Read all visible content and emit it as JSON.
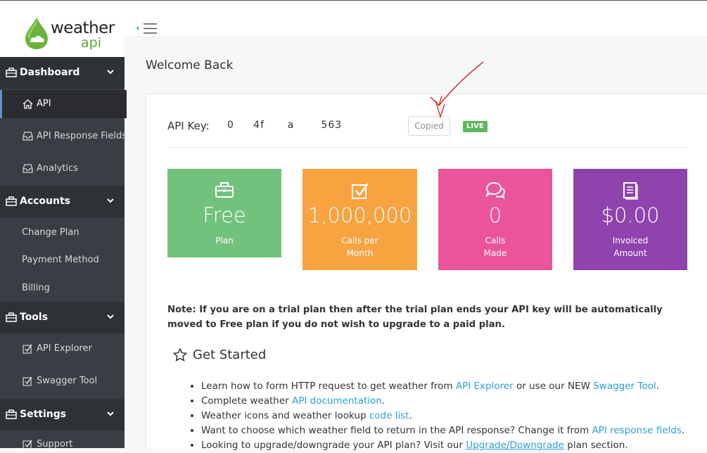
{
  "logo": {
    "word1": "weather",
    "word2": "api"
  },
  "sidebar": {
    "sections": [
      {
        "label": "Dashboard",
        "icon": "briefcase-icon"
      },
      {
        "label": "Accounts",
        "icon": "briefcase-icon"
      },
      {
        "label": "Tools",
        "icon": "briefcase-icon"
      },
      {
        "label": "Settings",
        "icon": "briefcase-icon"
      }
    ],
    "items": {
      "api": "API",
      "api_response_fields": "API Response Fields",
      "analytics": "Analytics",
      "change_plan": "Change Plan",
      "payment_method": "Payment Method",
      "billing": "Billing",
      "api_explorer": "API Explorer",
      "swagger_tool": "Swagger Tool",
      "support": "Support"
    }
  },
  "page": {
    "title": "Welcome Back"
  },
  "api": {
    "label": "API Key:",
    "key_display": "0     4f      a       563         ",
    "copied_label": "Copied",
    "status_badge": "LIVE"
  },
  "tiles": [
    {
      "value": "Free",
      "label": "Plan",
      "color": "#72c27e",
      "icon": "briefcase-icon"
    },
    {
      "value": "1,000,000",
      "label1": "Calls per",
      "label2": "Month",
      "color": "#f6a340",
      "icon": "check-square-icon"
    },
    {
      "value": "0",
      "label1": "Calls",
      "label2": "Made",
      "color": "#e9549a",
      "icon": "comments-icon"
    },
    {
      "value": "$0.00",
      "label1": "Invoiced",
      "label2": "Amount",
      "color": "#8e43ad",
      "icon": "document-icon"
    }
  ],
  "note": "Note: If you are on a trial plan then after the trial plan ends your API key will be automatically moved to Free plan if you do not wish to upgrade to a paid plan.",
  "get_started": {
    "title": "Get Started",
    "items": [
      {
        "pre": "Learn how to form HTTP request to get weather from ",
        "link1": "API Explorer",
        "mid": " or use our NEW ",
        "link2": "Swagger Tool",
        "post": "."
      },
      {
        "pre": "Complete weather ",
        "link1": "API documentation",
        "post": "."
      },
      {
        "pre": "Weather icons and weather lookup ",
        "link1": "code list",
        "post": "."
      },
      {
        "pre": "Want to choose which weather field to return in the API response? Change it from ",
        "link1": "API response fields",
        "post": "."
      },
      {
        "pre": "Looking to upgrade/downgrade your API plan? Visit our ",
        "link1": "Upgrade/Downgrade",
        "post": " plan section."
      }
    ]
  },
  "colors": {
    "sidebar_bg": "#3a3e44",
    "section_bg": "#2e3136",
    "link": "#2a9fd6",
    "live_green": "#5cb85c",
    "annotation_red": "#d62020"
  }
}
